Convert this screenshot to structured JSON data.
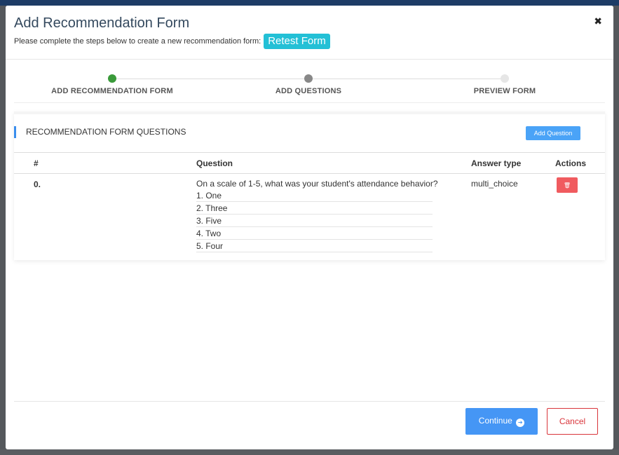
{
  "modal": {
    "title": "Add Recommendation Form",
    "subtitle": "Please complete the steps below to create a new recommendation form:",
    "form_name": "Retest Form",
    "close_glyph": "✖"
  },
  "stepper": {
    "steps": [
      {
        "label": "ADD RECOMMENDATION FORM",
        "state": "complete",
        "color": "#3a9a3a"
      },
      {
        "label": "ADD QUESTIONS",
        "state": "active",
        "color": "#888888"
      },
      {
        "label": "PREVIEW FORM",
        "state": "pending",
        "color": "#e6e6e6"
      }
    ]
  },
  "questions_card": {
    "heading": "RECOMMENDATION FORM QUESTIONS",
    "add_button": "Add Question",
    "columns": [
      "#",
      "Question",
      "Answer type",
      "Actions"
    ],
    "rows": [
      {
        "num": "0.",
        "question": "On a scale of 1-5, what was your student's attendance behavior?",
        "options": [
          "1. One",
          "2. Three",
          "3. Five",
          "4. Two",
          "5. Four"
        ],
        "answer_type": "multi_choice",
        "delete_glyph": "🗑"
      }
    ]
  },
  "footer": {
    "continue_label": "Continue",
    "continue_icon": "➔",
    "cancel_label": "Cancel"
  },
  "colors": {
    "accent_blue": "#4596f5",
    "badge_cyan": "#23c0d6",
    "danger_red": "#d9343a"
  }
}
